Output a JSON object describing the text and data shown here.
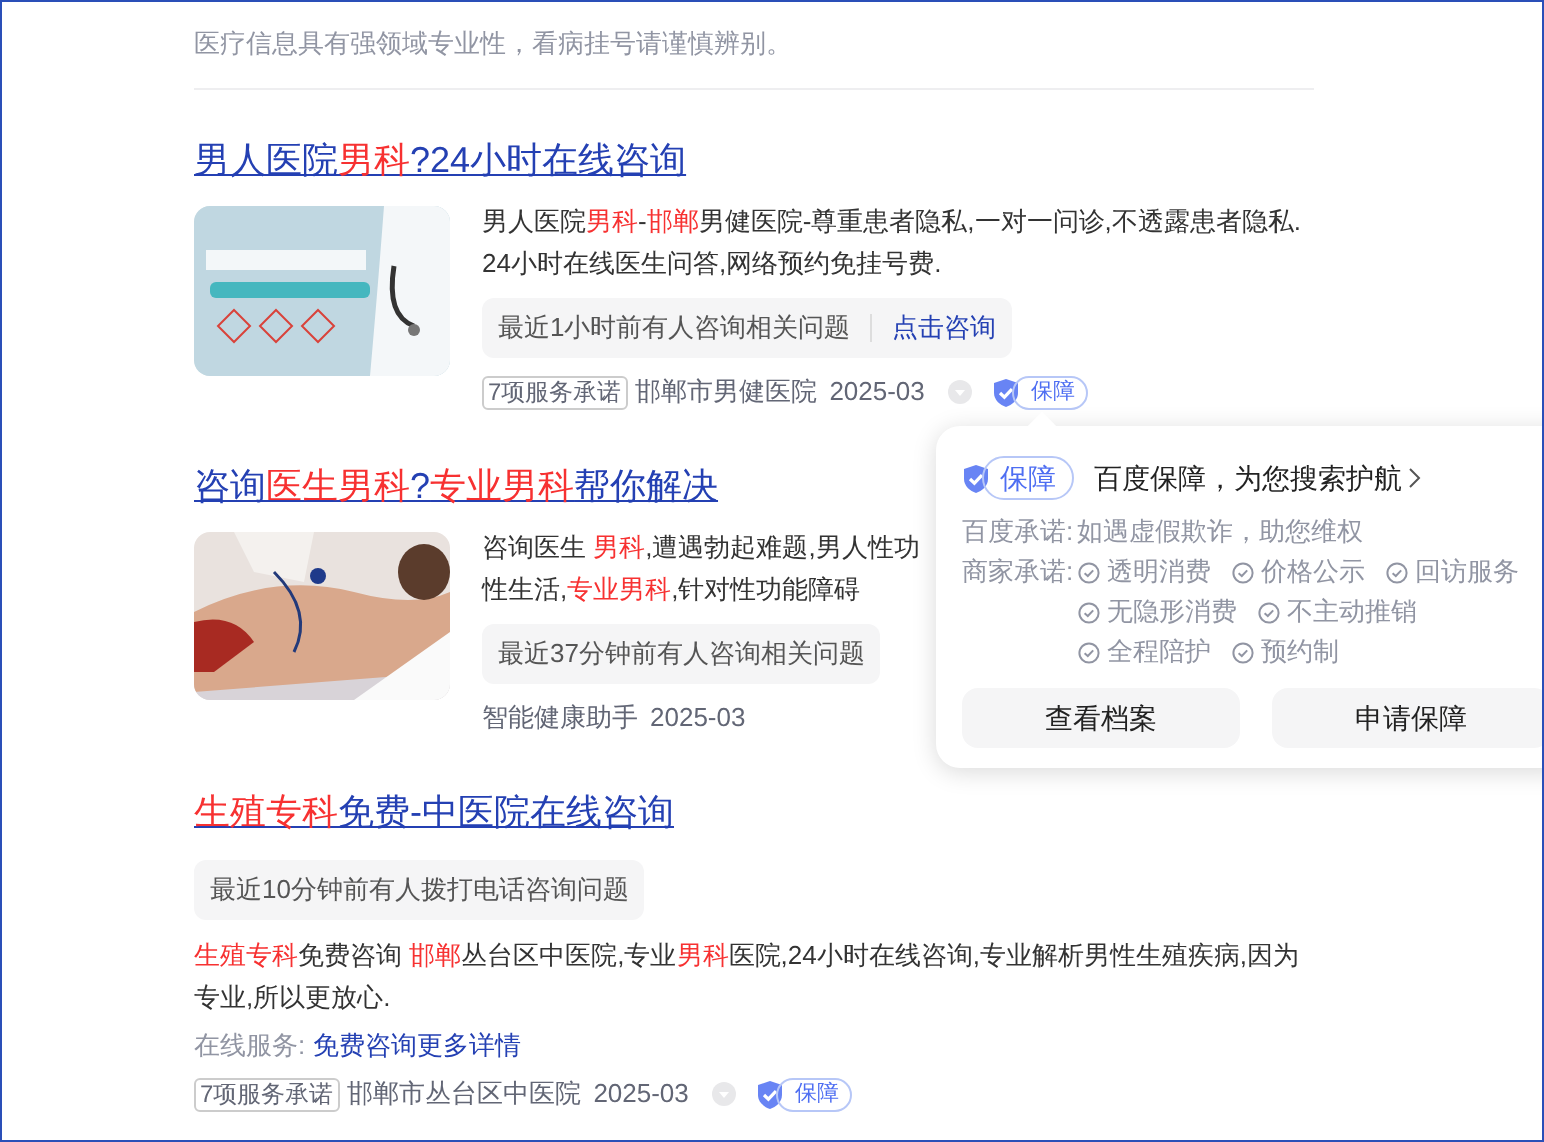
{
  "notice": "医疗信息具有强领域专业性，看病挂号请谨慎辨别。",
  "results": [
    {
      "title": "男人医院**男科**?24小时在线咨询",
      "thumbnail": {
        "kind": "picture"
      },
      "lines": [
        "男人医院**男科**-**邯郸**男健医院-尊重患者隐私,一对一问诊,不透露患者隐私.",
        "24小时在线医生问答,网络预约免挂号费."
      ],
      "chip": {
        "text": "最近1小时前有人咨询相关问题",
        "link": "点击咨询"
      },
      "footer": {
        "tag": "7项服务承诺",
        "source": "邯郸市男健医院",
        "date": "2025-03",
        "guarantee": "保障"
      }
    },
    {
      "title": "咨询**医生男科**?**专业男科**帮你解决",
      "thumbnail": {
        "kind": "picture"
      },
      "lines": [
        "咨询医生 **男科**,遭遇勃起难题,男人性功",
        "性生活,**专业男科**,针对性功能障碍"
      ],
      "chip": {
        "text": "最近37分钟前有人咨询相关问题"
      },
      "footer": {
        "source": "智能健康助手",
        "date": "2025-03"
      }
    },
    {
      "title": "**生殖专科**免费-中医院在线咨询",
      "chip": {
        "text": "最近10分钟前有人拨打电话咨询问题"
      },
      "lines": [
        "**生殖专科**免费咨询 **邯郸**丛台区中医院,专业**男科**医院,24小时在线咨询,专业解析男性生殖疾病,因为",
        "专业,所以更放心."
      ],
      "service": {
        "label": "在线服务:",
        "link": "免费咨询更多详情"
      },
      "footer": {
        "tag": "7项服务承诺",
        "source": "邯郸市丛台区中医院",
        "date": "2025-03",
        "guarantee": "保障"
      }
    }
  ],
  "popover": {
    "badge": "保障",
    "title": "百度保障，为您搜索护航",
    "baidu_promise": {
      "label": "百度承诺:",
      "text": "如遇虚假欺诈，助您维权"
    },
    "merchant_promise": {
      "label": "商家承诺:",
      "rows": [
        [
          "透明消费",
          "价格公示",
          "回访服务"
        ],
        [
          "无隐形消费",
          "不主动推销"
        ],
        [
          "全程陪护",
          "预约制"
        ]
      ]
    },
    "buttons": [
      "查看档案",
      "申请保障"
    ]
  }
}
